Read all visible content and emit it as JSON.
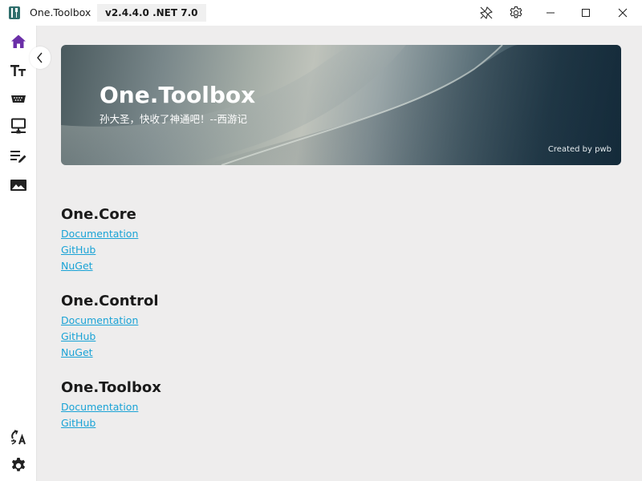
{
  "window": {
    "title": "One.Toolbox",
    "version": "v2.4.4.0 .NET 7.0"
  },
  "titlebar": {
    "buttons": [
      "pin-off-icon",
      "settings-icon",
      "minimize-icon",
      "maximize-icon",
      "close-icon"
    ]
  },
  "sidebar": {
    "items": [
      {
        "id": "home",
        "icon": "home-icon",
        "active": true
      },
      {
        "id": "text",
        "icon": "text-size-icon"
      },
      {
        "id": "serial",
        "icon": "serial-port-icon"
      },
      {
        "id": "network",
        "icon": "monitor-network-icon"
      },
      {
        "id": "notes",
        "icon": "edit-list-icon"
      },
      {
        "id": "image",
        "icon": "image-icon"
      }
    ],
    "bottom_items": [
      {
        "id": "translate",
        "icon": "translate-icon"
      },
      {
        "id": "settings",
        "icon": "settings-icon"
      }
    ]
  },
  "banner": {
    "title": "One.Toolbox",
    "subtitle": "孙大圣，快收了神通吧！--西游记",
    "credit": "Created by pwb"
  },
  "sections": [
    {
      "title": "One.Core",
      "links": [
        "Documentation",
        "GitHub",
        "NuGet"
      ]
    },
    {
      "title": "One.Control",
      "links": [
        "Documentation",
        "GitHub",
        "NuGet"
      ]
    },
    {
      "title": "One.Toolbox",
      "links": [
        "Documentation",
        "GitHub"
      ]
    }
  ],
  "colors": {
    "accent": "#6b2fa8",
    "link": "#1aa3d6",
    "content_background": "#eeeded"
  }
}
